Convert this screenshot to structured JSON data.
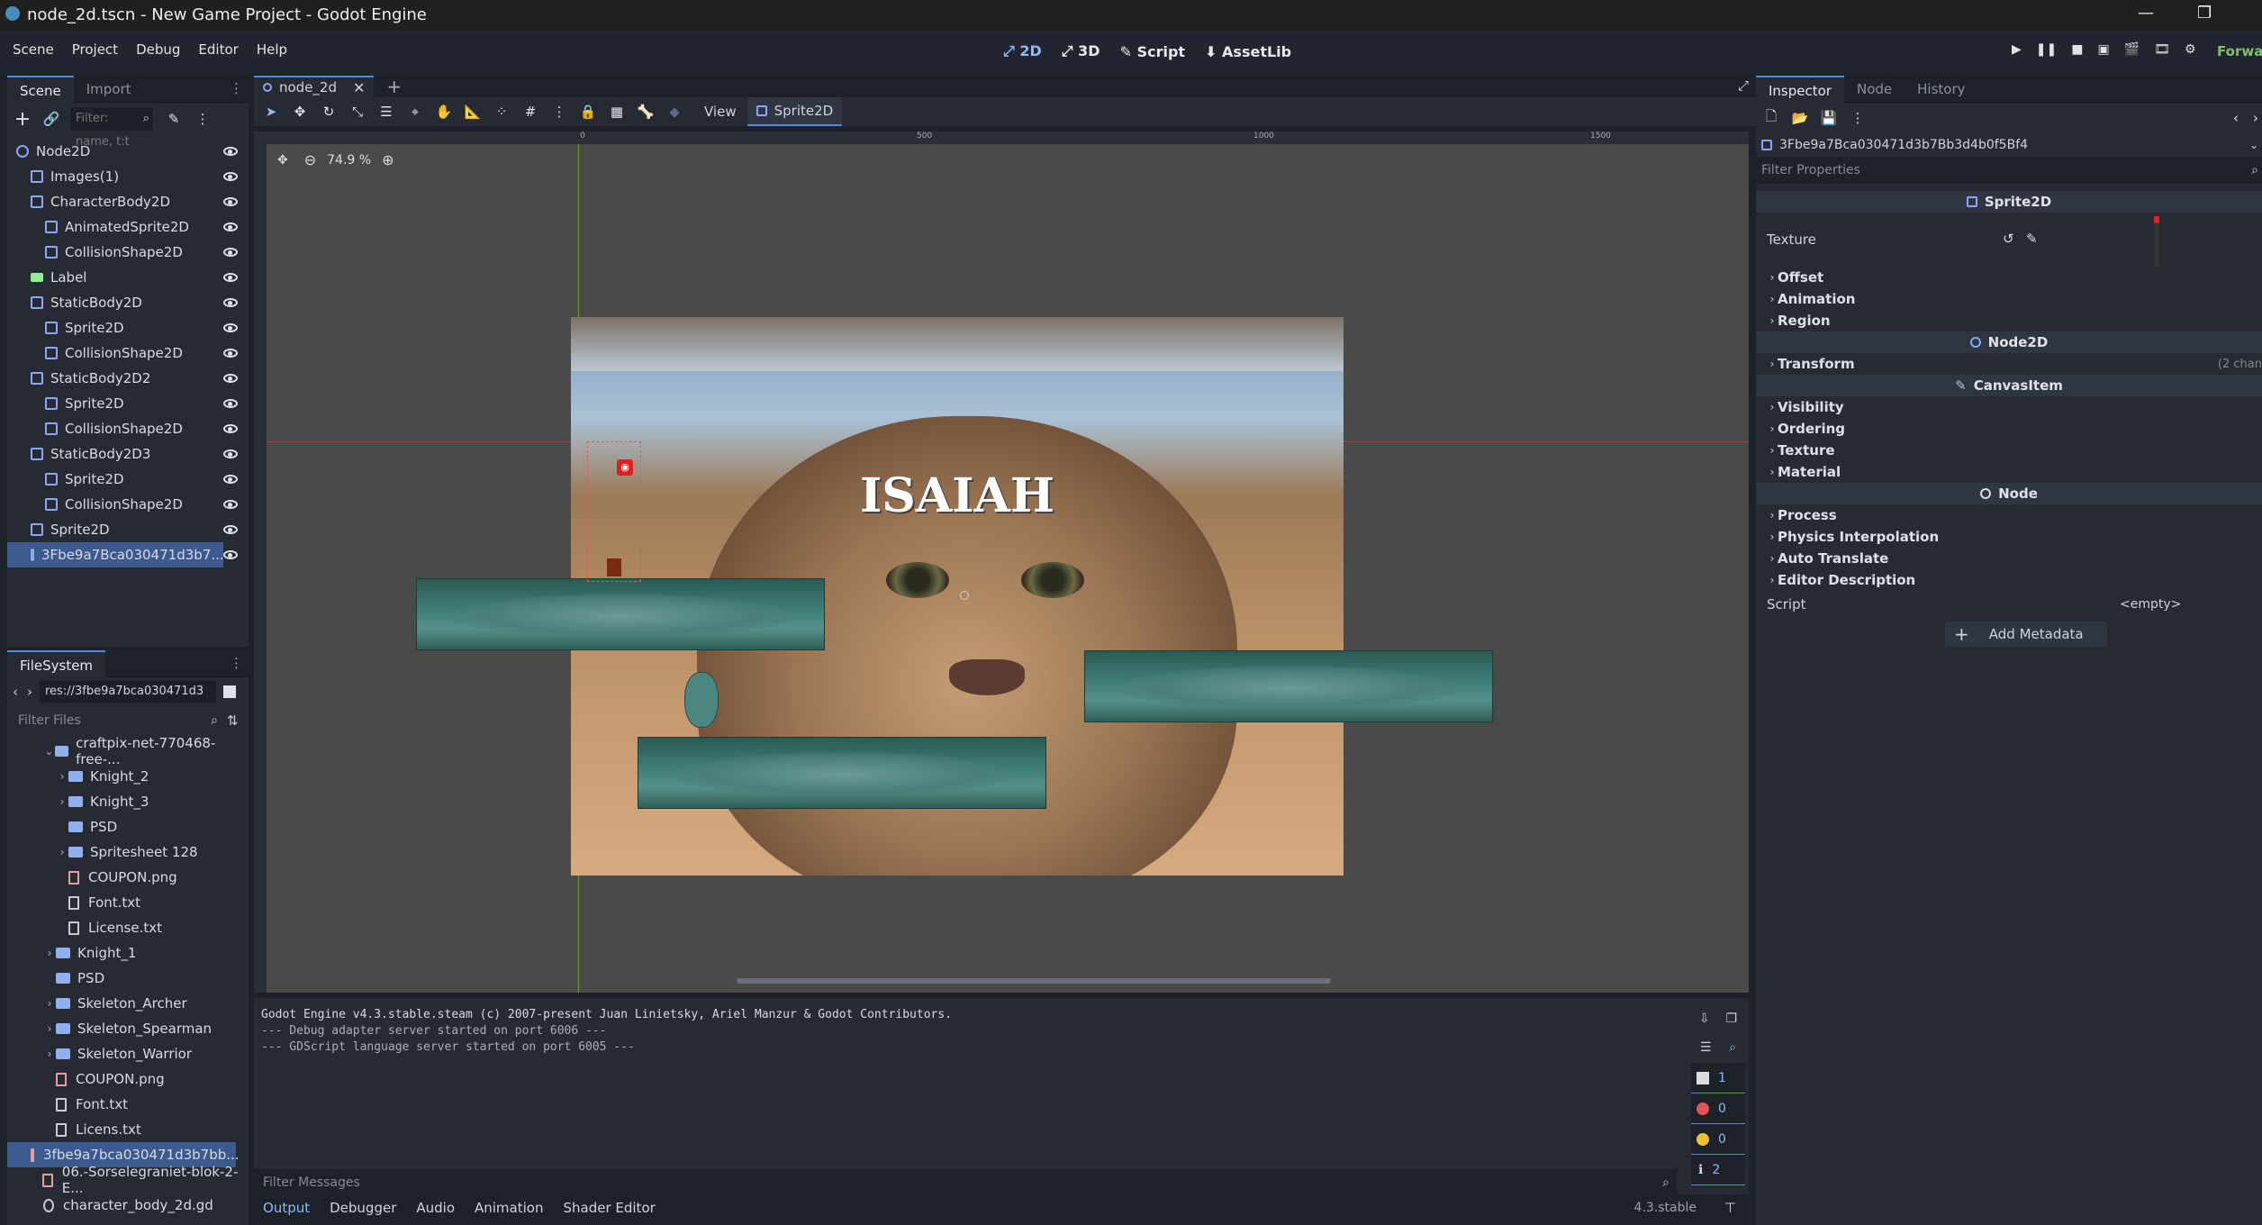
{
  "window": {
    "title": "node_2d.tscn - New Game Project - Godot Engine"
  },
  "menu": [
    "Scene",
    "Project",
    "Debug",
    "Editor",
    "Help"
  ],
  "modes": [
    "2D",
    "3D",
    "Script",
    "AssetLib"
  ],
  "renderer": "Forwar",
  "scene_dock": {
    "tabs": [
      "Scene",
      "Import"
    ],
    "filter_placeholder": "Filter: name, t:t",
    "tree": [
      {
        "label": "Node2D",
        "depth": 0,
        "icon": "node2d-icon"
      },
      {
        "label": "Images(1)",
        "depth": 1,
        "icon": "sprite-icon"
      },
      {
        "label": "CharacterBody2D",
        "depth": 1,
        "icon": "character-body-icon"
      },
      {
        "label": "AnimatedSprite2D",
        "depth": 2,
        "icon": "animated-sprite-icon"
      },
      {
        "label": "CollisionShape2D",
        "depth": 2,
        "icon": "collision-shape-icon"
      },
      {
        "label": "Label",
        "depth": 1,
        "icon": "label-icon"
      },
      {
        "label": "StaticBody2D",
        "depth": 1,
        "icon": "static-body-icon"
      },
      {
        "label": "Sprite2D",
        "depth": 2,
        "icon": "sprite-icon"
      },
      {
        "label": "CollisionShape2D",
        "depth": 2,
        "icon": "collision-shape-icon"
      },
      {
        "label": "StaticBody2D2",
        "depth": 1,
        "icon": "static-body-icon"
      },
      {
        "label": "Sprite2D",
        "depth": 2,
        "icon": "sprite-icon"
      },
      {
        "label": "CollisionShape2D",
        "depth": 2,
        "icon": "collision-shape-icon"
      },
      {
        "label": "StaticBody2D3",
        "depth": 1,
        "icon": "static-body-icon"
      },
      {
        "label": "Sprite2D",
        "depth": 2,
        "icon": "sprite-icon"
      },
      {
        "label": "CollisionShape2D",
        "depth": 2,
        "icon": "collision-shape-icon"
      },
      {
        "label": "Sprite2D",
        "depth": 1,
        "icon": "sprite-icon"
      },
      {
        "label": "3Fbe9a7Bca030471d3b7...",
        "depth": 1,
        "icon": "sprite-icon",
        "selected": true
      }
    ]
  },
  "filesystem": {
    "tab": "FileSystem",
    "path": "res://3fbe9a7bca030471d3",
    "filter_placeholder": "Filter Files",
    "items": [
      {
        "label": "craftpix-net-770468-free-...",
        "depth": 1,
        "type": "folder",
        "expanded": true
      },
      {
        "label": "Knight_2",
        "depth": 2,
        "type": "folder"
      },
      {
        "label": "Knight_3",
        "depth": 2,
        "type": "folder"
      },
      {
        "label": "PSD",
        "depth": 2,
        "type": "folder",
        "noarrow": true
      },
      {
        "label": "Spritesheet 128",
        "depth": 2,
        "type": "folder"
      },
      {
        "label": "COUPON.png",
        "depth": 2,
        "type": "image"
      },
      {
        "label": "Font.txt",
        "depth": 2,
        "type": "text"
      },
      {
        "label": "License.txt",
        "depth": 2,
        "type": "text"
      },
      {
        "label": "Knight_1",
        "depth": 1,
        "type": "folder"
      },
      {
        "label": "PSD",
        "depth": 1,
        "type": "folder",
        "noarrow": true
      },
      {
        "label": "Skeleton_Archer",
        "depth": 1,
        "type": "folder"
      },
      {
        "label": "Skeleton_Spearman",
        "depth": 1,
        "type": "folder"
      },
      {
        "label": "Skeleton_Warrior",
        "depth": 1,
        "type": "folder"
      },
      {
        "label": "COUPON.png",
        "depth": 1,
        "type": "image"
      },
      {
        "label": "Font.txt",
        "depth": 1,
        "type": "text"
      },
      {
        "label": "Licens.txt",
        "depth": 1,
        "type": "text"
      },
      {
        "label": "3fbe9a7bca030471d3b7bb...",
        "depth": 0,
        "type": "image",
        "selected": true
      },
      {
        "label": "06.-Sorselegraniet-blok-2-E...",
        "depth": 0,
        "type": "image"
      },
      {
        "label": "character_body_2d.gd",
        "depth": 0,
        "type": "script"
      }
    ]
  },
  "editor": {
    "scene_tab": "node_2d",
    "toolbar": {
      "view_label": "View",
      "selected_node": "Sprite2D"
    },
    "zoom": "74.9 %",
    "ruler_ticks": [
      "0",
      "500",
      "1000",
      "1500"
    ],
    "canvas_text": "ISAIAH"
  },
  "output": {
    "lines": [
      "Godot Engine v4.3.stable.steam (c) 2007-present Juan Linietsky, Ariel Manzur & Godot Contributors.",
      "--- Debug adapter server started on port 6006 ---",
      "--- GDScript language server started on port 6005 ---"
    ],
    "filter_placeholder": "Filter Messages",
    "counts": {
      "messages": "1",
      "errors": "0",
      "warnings": "0",
      "info": "2"
    },
    "bottom_tabs": [
      "Output",
      "Debugger",
      "Audio",
      "Animation",
      "Shader Editor"
    ],
    "version": "4.3.stable"
  },
  "inspector": {
    "tabs": [
      "Inspector",
      "Node",
      "History"
    ],
    "resource": "3Fbe9a7Bca030471d3b7Bb3d4b0f5Bf4",
    "filter_placeholder": "Filter Properties",
    "sections": [
      {
        "header": "Sprite2D",
        "rows": []
      },
      {
        "header": "",
        "rows": [
          "Offset",
          "Animation",
          "Region"
        ]
      },
      {
        "header": "Node2D",
        "rows": [
          "Transform"
        ]
      },
      {
        "header": "CanvasItem",
        "rows": [
          "Visibility",
          "Ordering",
          "Texture",
          "Material"
        ]
      },
      {
        "header": "Node",
        "rows": [
          "Process",
          "Physics Interpolation",
          "Auto Translate",
          "Editor Description"
        ]
      }
    ],
    "texture_label": "Texture",
    "transform_note": "(2 chan",
    "script_label": "Script",
    "script_value": "<empty>",
    "add_metadata": "Add Metadata"
  },
  "colors": {
    "accent": "#4c8ce6",
    "selection": "#3d5a8f"
  }
}
